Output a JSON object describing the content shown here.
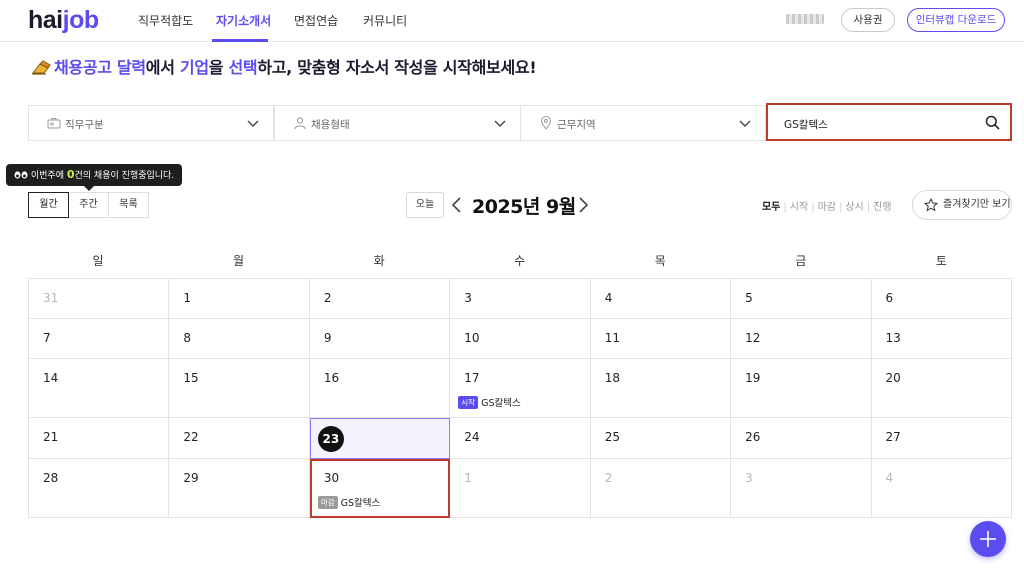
{
  "brand": {
    "logo_prefix": "hai",
    "logo_suffix": "job",
    "accent": "#5b4cf0"
  },
  "nav": {
    "items": [
      {
        "label": "직무적합도"
      },
      {
        "label": "자기소개서"
      },
      {
        "label": "면접연습"
      },
      {
        "label": "커뮤니티"
      }
    ],
    "active_index": 1,
    "ticket_button": "사용권",
    "download_button": "인터뷰캡 다운로드"
  },
  "headline": {
    "part1": "채용공고 달력",
    "part2": "에서 ",
    "part3": "기업",
    "part4": "을 ",
    "part5": "선택",
    "part6": "하고, 맞춤형 자소서 작성을 시작해보세요!"
  },
  "filters": {
    "job_category": {
      "label": "직무구분",
      "icon": "briefcase-icon"
    },
    "employment_type": {
      "label": "채용형태",
      "icon": "person-icon"
    },
    "location": {
      "label": "근무지역",
      "icon": "map-pin-icon"
    },
    "search_value": "GS칼텍스"
  },
  "tooltip": {
    "prefix": "이번주에 ",
    "count": "0",
    "suffix": "건의 채용이 진행중입니다."
  },
  "views": {
    "month": "월간",
    "week": "주간",
    "list": "목록",
    "active": "month"
  },
  "month_nav": {
    "today_label": "오늘",
    "title": "2025년 9월"
  },
  "status_filter": {
    "options": [
      "모두",
      "시작",
      "마감",
      "상시",
      "진행"
    ],
    "active_index": 0
  },
  "favorites_button": "즐겨찾기만 보기",
  "calendar": {
    "weekdays": [
      "일",
      "월",
      "화",
      "수",
      "목",
      "금",
      "토"
    ],
    "weeks": [
      [
        {
          "d": "31",
          "muted": true
        },
        {
          "d": "1"
        },
        {
          "d": "2"
        },
        {
          "d": "3"
        },
        {
          "d": "4"
        },
        {
          "d": "5"
        },
        {
          "d": "6"
        }
      ],
      [
        {
          "d": "7"
        },
        {
          "d": "8"
        },
        {
          "d": "9"
        },
        {
          "d": "10"
        },
        {
          "d": "11"
        },
        {
          "d": "12"
        },
        {
          "d": "13"
        }
      ],
      [
        {
          "d": "14"
        },
        {
          "d": "15"
        },
        {
          "d": "16"
        },
        {
          "d": "17",
          "event": {
            "badge": "시작",
            "type": "start",
            "company": "GS칼텍스"
          }
        },
        {
          "d": "18"
        },
        {
          "d": "19"
        },
        {
          "d": "20"
        }
      ],
      [
        {
          "d": "21"
        },
        {
          "d": "22"
        },
        {
          "d": "23",
          "today": true
        },
        {
          "d": "24"
        },
        {
          "d": "25"
        },
        {
          "d": "26"
        },
        {
          "d": "27"
        }
      ],
      [
        {
          "d": "28"
        },
        {
          "d": "29"
        },
        {
          "d": "30",
          "highlight": true,
          "event": {
            "badge": "마감",
            "type": "end",
            "company": "GS칼텍스"
          }
        },
        {
          "d": "1",
          "muted": true
        },
        {
          "d": "2",
          "muted": true
        },
        {
          "d": "3",
          "muted": true
        },
        {
          "d": "4",
          "muted": true
        }
      ]
    ]
  },
  "colors": {
    "start_badge": "#5b4cf0",
    "end_badge": "#9a9a9a",
    "highlight_box": "#c0392b",
    "today_bg": "#f4f2ff"
  }
}
